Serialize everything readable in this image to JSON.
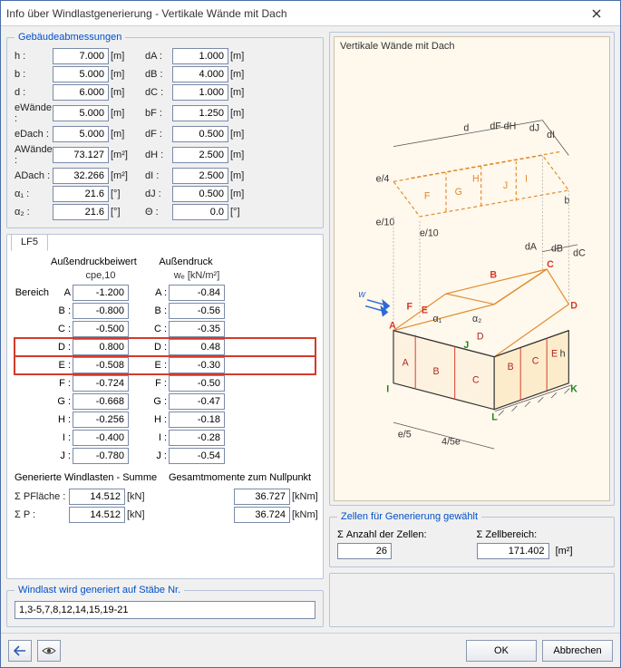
{
  "window": {
    "title": "Info über Windlastgenerierung  -  Vertikale Wände mit Dach"
  },
  "dimensions": {
    "legend": "Gebäudeabmessungen",
    "left": [
      {
        "sym": "h :",
        "val": "7.000",
        "unit": "[m]"
      },
      {
        "sym": "b :",
        "val": "5.000",
        "unit": "[m]"
      },
      {
        "sym": "d :",
        "val": "6.000",
        "unit": "[m]"
      },
      {
        "sym": "eWände :",
        "val": "5.000",
        "unit": "[m]"
      },
      {
        "sym": "eDach :",
        "val": "5.000",
        "unit": "[m]"
      },
      {
        "sym": "AWände :",
        "val": "73.127",
        "unit": "[m²]"
      },
      {
        "sym": "ADach :",
        "val": "32.266",
        "unit": "[m²]"
      },
      {
        "sym": "α₁ :",
        "val": "21.6",
        "unit": "[°]"
      },
      {
        "sym": "α₂ :",
        "val": "21.6",
        "unit": "[°]"
      }
    ],
    "right": [
      {
        "sym": "dA :",
        "val": "1.000",
        "unit": "[m]"
      },
      {
        "sym": "dB :",
        "val": "4.000",
        "unit": "[m]"
      },
      {
        "sym": "dC :",
        "val": "1.000",
        "unit": "[m]"
      },
      {
        "sym": "bF :",
        "val": "1.250",
        "unit": "[m]"
      },
      {
        "sym": "dF :",
        "val": "0.500",
        "unit": "[m]"
      },
      {
        "sym": "dH :",
        "val": "2.500",
        "unit": "[m]"
      },
      {
        "sym": "dI :",
        "val": "2.500",
        "unit": "[m]"
      },
      {
        "sym": "dJ :",
        "val": "0.500",
        "unit": "[m]"
      },
      {
        "sym": "Θ :",
        "val": "0.0",
        "unit": "[°]"
      }
    ]
  },
  "tab": {
    "label": "LF5",
    "head_left": "Außendruckbeiwert",
    "head_right": "Außendruck",
    "sub_left": "cpe,10",
    "sub_right": "wₑ [kN/m²]",
    "area_label": "Bereich",
    "rows": [
      {
        "k": "A",
        "cpe": "-1.200",
        "we": "-0.84",
        "hl": false
      },
      {
        "k": "B :",
        "cpe": "-0.800",
        "we": "-0.56",
        "hl": false
      },
      {
        "k": "C :",
        "cpe": "-0.500",
        "we": "-0.35",
        "hl": false
      },
      {
        "k": "D :",
        "cpe": "0.800",
        "we": "0.48",
        "hl": true
      },
      {
        "k": "E :",
        "cpe": "-0.508",
        "we": "-0.30",
        "hl": true
      },
      {
        "k": "F :",
        "cpe": "-0.724",
        "we": "-0.50",
        "hl": false
      },
      {
        "k": "G :",
        "cpe": "-0.668",
        "we": "-0.47",
        "hl": false
      },
      {
        "k": "H :",
        "cpe": "-0.256",
        "we": "-0.18",
        "hl": false
      },
      {
        "k": "I :",
        "cpe": "-0.400",
        "we": "-0.28",
        "hl": false
      },
      {
        "k": "J :",
        "cpe": "-0.780",
        "we": "-0.54",
        "hl": false
      }
    ],
    "sum_title_left": "Generierte Windlasten - Summe",
    "sum_title_right": "Gesamtmomente zum Nullpunkt",
    "sums": [
      {
        "l": "Σ PFläche :",
        "lv": "14.512",
        "lu": "[kN]",
        "rv": "36.727",
        "ru": "[kNm]"
      },
      {
        "l": "Σ P :",
        "lv": "14.512",
        "lu": "[kN]",
        "rv": "36.724",
        "ru": "[kNm]"
      }
    ]
  },
  "image": {
    "title": "Vertikale Wände mit Dach"
  },
  "cells": {
    "legend": "Zellen für Generierung gewählt",
    "count_label": "Σ Anzahl der Zellen:",
    "count_value": "26",
    "area_label": "Σ Zellbereich:",
    "area_value": "171.402",
    "area_unit": "[m²]"
  },
  "generated": {
    "legend": "Windlast wird generiert auf Stäbe Nr.",
    "value": "1,3-5,7,8,12,14,15,19-21"
  },
  "footer": {
    "ok": "OK",
    "cancel": "Abbrechen"
  }
}
